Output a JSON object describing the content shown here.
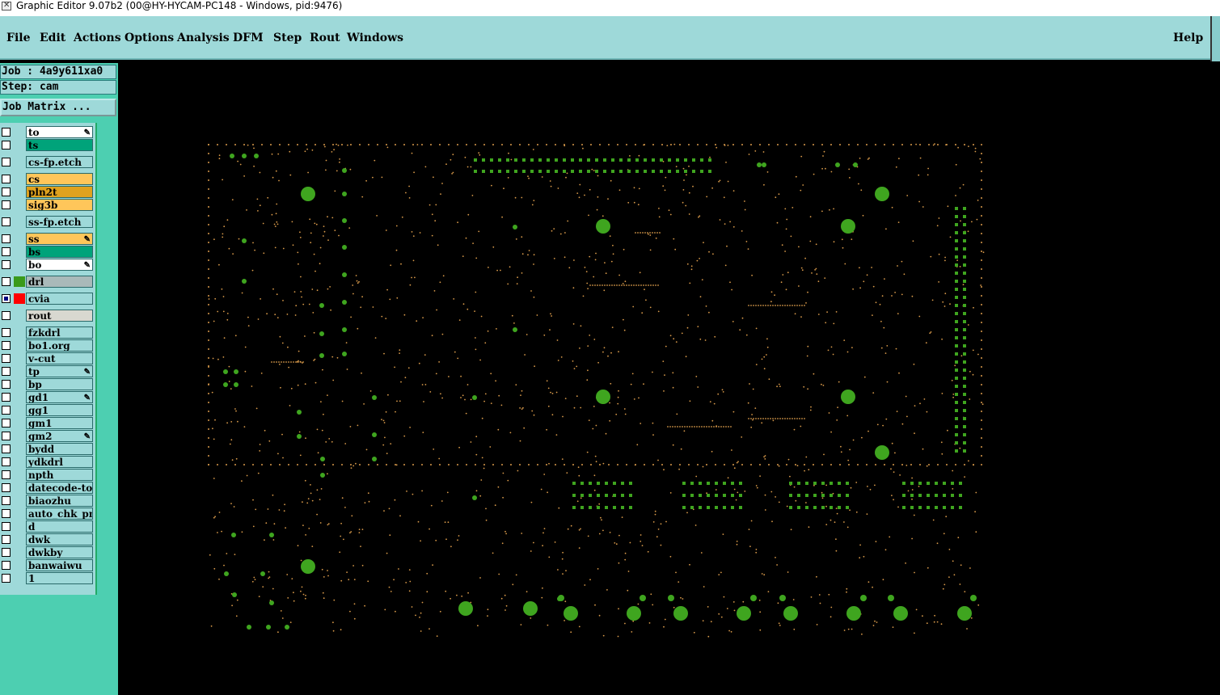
{
  "window": {
    "title": "Graphic Editor 9.07b2 (00@HY-HYCAM-PC148 - Windows, pid:9476)"
  },
  "menu": {
    "items": [
      "File",
      "Edit",
      "Actions",
      "Options",
      "Analysis",
      "DFM",
      "Step",
      "Rout",
      "Windows"
    ],
    "help": "Help"
  },
  "job": {
    "job_label": "Job : 4a9y611xa0",
    "step_label": "Step: cam",
    "matrix_button": "Job Matrix ..."
  },
  "layers": [
    {
      "name": "to",
      "color": "#ffffff",
      "checked": false,
      "mark": true,
      "group": 0
    },
    {
      "name": "ts",
      "color": "#00a37a",
      "checked": false,
      "mark": false,
      "group": 0
    },
    {
      "name": "cs-fp.etch",
      "color": "#9ed9d9",
      "checked": false,
      "mark": false,
      "group": 1
    },
    {
      "name": "cs",
      "color": "#ffc65a",
      "checked": false,
      "mark": false,
      "group": 2
    },
    {
      "name": "pln2t",
      "color": "#e0a21e",
      "checked": false,
      "mark": false,
      "group": 2
    },
    {
      "name": "sig3b",
      "color": "#ffc65a",
      "checked": false,
      "mark": false,
      "group": 2
    },
    {
      "name": "ss-fp.etch",
      "color": "#9ed9d9",
      "checked": false,
      "mark": false,
      "group": 3
    },
    {
      "name": "ss",
      "color": "#ffc65a",
      "checked": false,
      "mark": true,
      "group": 4
    },
    {
      "name": "bs",
      "color": "#00a37a",
      "checked": false,
      "mark": false,
      "group": 4
    },
    {
      "name": "bo",
      "color": "#ffffff",
      "checked": false,
      "mark": true,
      "group": 4
    },
    {
      "name": "drl",
      "color": "#a9b9b9",
      "checked": false,
      "mark": false,
      "group": 5,
      "swatch": "#3a9a1a"
    },
    {
      "name": "cvia",
      "color": "#9ed9d9",
      "checked": true,
      "mark": false,
      "group": 6,
      "swatch": "#ff0000"
    },
    {
      "name": "rout",
      "color": "#d8d8d0",
      "checked": false,
      "mark": false,
      "group": 7
    },
    {
      "name": "fzkdrl",
      "color": "#9ed9d9",
      "checked": false,
      "mark": false,
      "group": 8
    },
    {
      "name": "bo1.org",
      "color": "#9ed9d9",
      "checked": false,
      "mark": false,
      "group": 8
    },
    {
      "name": "v-cut",
      "color": "#9ed9d9",
      "checked": false,
      "mark": false,
      "group": 8
    },
    {
      "name": "tp",
      "color": "#9ed9d9",
      "checked": false,
      "mark": true,
      "group": 8
    },
    {
      "name": "bp",
      "color": "#9ed9d9",
      "checked": false,
      "mark": false,
      "group": 8
    },
    {
      "name": "gd1",
      "color": "#9ed9d9",
      "checked": false,
      "mark": true,
      "group": 8
    },
    {
      "name": "gg1",
      "color": "#9ed9d9",
      "checked": false,
      "mark": false,
      "group": 8
    },
    {
      "name": "gm1",
      "color": "#9ed9d9",
      "checked": false,
      "mark": false,
      "group": 8
    },
    {
      "name": "gm2",
      "color": "#9ed9d9",
      "checked": false,
      "mark": true,
      "group": 8
    },
    {
      "name": "bydd",
      "color": "#9ed9d9",
      "checked": false,
      "mark": false,
      "group": 8
    },
    {
      "name": "ydkdrl",
      "color": "#9ed9d9",
      "checked": false,
      "mark": false,
      "group": 8
    },
    {
      "name": "npth",
      "color": "#9ed9d9",
      "checked": false,
      "mark": false,
      "group": 8
    },
    {
      "name": "datecode-to",
      "color": "#9ed9d9",
      "checked": false,
      "mark": false,
      "group": 8
    },
    {
      "name": "biaozhu",
      "color": "#9ed9d9",
      "checked": false,
      "mark": false,
      "group": 8
    },
    {
      "name": "auto_chk_pn",
      "color": "#9ed9d9",
      "checked": false,
      "mark": false,
      "group": 8
    },
    {
      "name": "d",
      "color": "#9ed9d9",
      "checked": false,
      "mark": false,
      "group": 8
    },
    {
      "name": "dwk",
      "color": "#9ed9d9",
      "checked": false,
      "mark": false,
      "group": 8
    },
    {
      "name": "dwkby",
      "color": "#9ed9d9",
      "checked": false,
      "mark": false,
      "group": 8
    },
    {
      "name": "banwaiwu",
      "color": "#9ed9d9",
      "checked": false,
      "mark": false,
      "group": 8
    },
    {
      "name": "1",
      "color": "#9ed9d9",
      "checked": false,
      "mark": false,
      "group": 8
    }
  ],
  "colors": {
    "pad_green": "#3fa51f",
    "via_orange": "#d99a4a",
    "canvas_bg": "#000000"
  }
}
